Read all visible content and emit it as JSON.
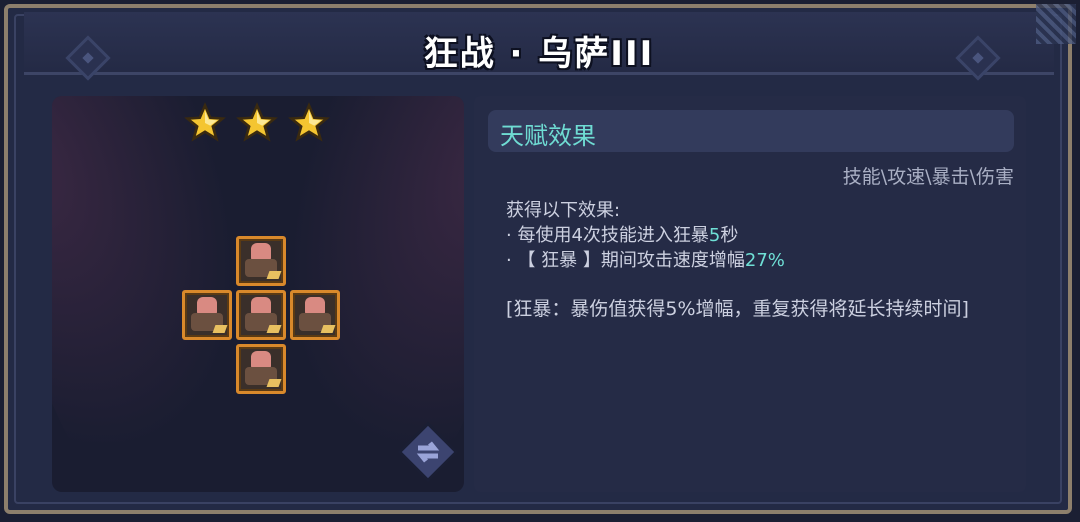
{
  "title": "狂战 · 乌萨III",
  "stars": 3,
  "colors": {
    "accent": "#6fdcd3",
    "star": "#f4c531",
    "unit_border": "#d9892b"
  },
  "talent": {
    "header": "天赋效果",
    "tags": "技能\\攻速\\暴击\\伤害",
    "intro": "获得以下效果:",
    "line1_prefix": "· 每使用4次技能进入狂暴",
    "line1_value": "5",
    "line1_suffix": "秒",
    "line2_prefix": "· 【 狂暴 】期间攻击速度增幅",
    "line2_value": "27%",
    "note": "[狂暴：暴伤值获得5%增幅，重复获得将延长持续时间]"
  },
  "icons": {
    "star": "star-icon",
    "swap": "swap-icon"
  }
}
